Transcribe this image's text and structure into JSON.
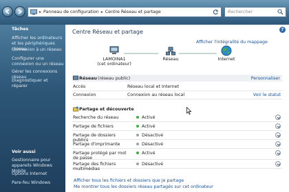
{
  "address": {
    "crumbs": [
      "Panneau de configuration",
      "Centre Réseau et partage"
    ],
    "search_placeholder": "Rechercher"
  },
  "left": {
    "tasks_title": "Tâches",
    "tasks": [
      "Afficher les ordinateurs et les périphériques réseau",
      "Connexion à un réseau",
      "Configurer une connexion ou un réseau",
      "Gérer les connexions réseau",
      "Diagnostiquer et réparer"
    ],
    "see_also_title": "Voir aussi",
    "see_also": [
      "Gestionnaire pour appareils Windows Mobile",
      "Options Internet",
      "Pare-feu Windows"
    ]
  },
  "main": {
    "title": "Centre Réseau et partage",
    "full_map_link": "Afficher l'intégralité du mappage",
    "map": {
      "computer_name": "LAMOINA1",
      "computer_sub": "(cet ordinateur)",
      "network_label": "Réseau",
      "internet_label": "Internet"
    },
    "network": {
      "name": "Réseau",
      "type": "(réseau public)",
      "customize": "Personnaliser",
      "rows": [
        {
          "label": "Accès",
          "value": "Réseau local et Internet",
          "action": ""
        },
        {
          "label": "Connexion",
          "value": "Connexion au réseau local",
          "action": "Voir le statut"
        }
      ]
    },
    "sharing": {
      "title": "Partage et découverte",
      "rows": [
        {
          "label": "Recherche du réseau",
          "state": "Activé",
          "on": true
        },
        {
          "label": "Partage de fichiers",
          "state": "Activé",
          "on": true
        },
        {
          "label": "Partage de dossiers publics",
          "state": "Désactivé",
          "on": false
        },
        {
          "label": "Partage d'imprimante",
          "state": "Désactivé",
          "on": false
        },
        {
          "label": "Partage protégé par mot de passe",
          "state": "Activé",
          "on": true
        },
        {
          "label": "Partage des fichiers multimédias",
          "state": "Désactivé",
          "on": false
        }
      ]
    },
    "footer_links": [
      "Afficher tous les fichiers et dossiers que je partage",
      "Me montrer tous les dossiers réseau partagés sur cet ordinateur"
    ]
  },
  "colors": {
    "on_dot": "#3cae3c",
    "off_dot": "#9aa3ab",
    "link": "#1b4f95"
  }
}
